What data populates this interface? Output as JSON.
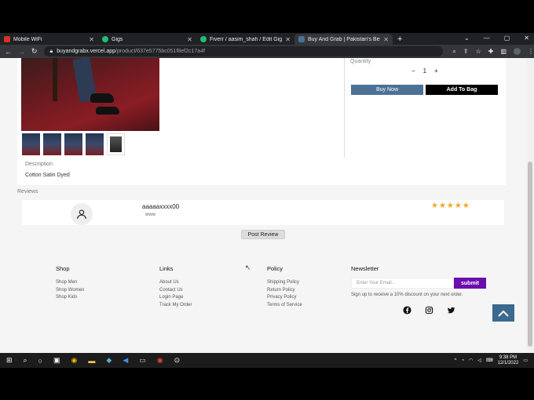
{
  "browser": {
    "tabs": [
      {
        "title": "Mobile WiFi",
        "color": "#d93025"
      },
      {
        "title": "Gigs",
        "color": "#1dbf73"
      },
      {
        "title": "Fiverr / aasim_shah / Edit Gig",
        "color": "#1dbf73"
      },
      {
        "title": "Buy And Grab | Pakistan's Best O",
        "color": "#4b7196"
      }
    ],
    "url_host": "buyandgrabx.vercel.app",
    "url_path": "/product/637e5775bc051f8ef2c17a4f"
  },
  "product": {
    "quantity_label": "Quantity",
    "quantity_minus": "−",
    "quantity_value": "1",
    "quantity_plus": "+",
    "buy_now": "Buy Now",
    "add_to_bag": "Add To Bag",
    "description_label": "Description",
    "description_value": "Cotton Satin Dyed"
  },
  "reviews": {
    "heading": "Reviews",
    "items": [
      {
        "name": "aaaaaxxxx00",
        "text": "www",
        "stars": "★★★★★"
      }
    ],
    "post_button": "Post Review"
  },
  "footer": {
    "shop": {
      "title": "Shop",
      "links": [
        "Shop Men",
        "Shop Women",
        "Shop Kids"
      ]
    },
    "links": {
      "title": "Links",
      "links": [
        "About Us",
        "Contact Us",
        "Login Page",
        "Track My Order"
      ]
    },
    "policy": {
      "title": "Policy",
      "links": [
        "Shipping Policy",
        "Return Policy",
        "Privacy Policy",
        "Terms of Service"
      ]
    },
    "newsletter": {
      "title": "Newsletter",
      "placeholder": "Enter Your Email...",
      "submit": "submit",
      "subtext": "Sign up to receive a 10% discount on your next order."
    }
  },
  "taskbar": {
    "time": "9:38 PM",
    "date": "12/1/2022"
  }
}
